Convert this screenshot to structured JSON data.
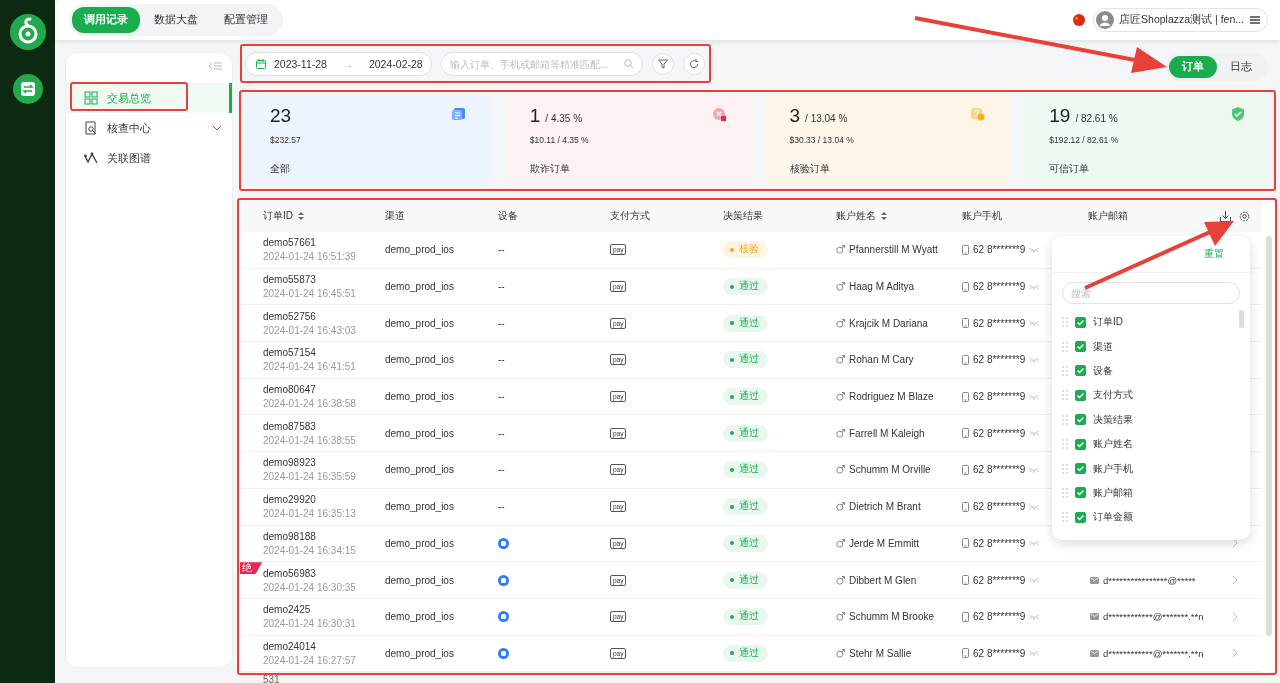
{
  "nav": {
    "tabs": [
      {
        "label": "调用记录",
        "selected": true
      },
      {
        "label": "数据大盘",
        "selected": false
      },
      {
        "label": "配置管理",
        "selected": false
      }
    ],
    "account": "店匠Shoplazza测试 | fen..."
  },
  "sidebar": {
    "items": [
      {
        "label": "交易总览",
        "kind": "overview",
        "selected": true
      },
      {
        "label": "核查中心",
        "kind": "review",
        "selected": false,
        "expanded": false
      },
      {
        "label": "关联图谱",
        "kind": "graph",
        "selected": false
      }
    ]
  },
  "filter": {
    "start_date": "2023-11-28",
    "separator": "→",
    "end_date": "2024-02-28",
    "search": {
      "placeholder": "输入订单、手机或邮箱等精准匹配..."
    }
  },
  "view_switch": [
    {
      "label": "订单",
      "selected": true
    },
    {
      "label": "日志",
      "selected": false
    }
  ],
  "stats": [
    {
      "kind": "all",
      "count": "23",
      "amount": "$232.57",
      "label": "全部"
    },
    {
      "kind": "fraud",
      "count": "1",
      "share": "/ 4.35 %",
      "amount": "$10.11 / 4.35 %",
      "label": "欺诈订单"
    },
    {
      "kind": "review",
      "count": "3",
      "share": "/ 13.04 %",
      "amount": "$30.33 / 13.04 %",
      "label": "核验订单"
    },
    {
      "kind": "trusted",
      "count": "19",
      "share": "/ 82.61 %",
      "amount": "$192.12 / 82.61 %",
      "label": "可信订单"
    }
  ],
  "table": {
    "columns": [
      {
        "label": "订单ID",
        "sortable": true
      },
      {
        "label": "渠道",
        "sortable": false
      },
      {
        "label": "设备",
        "sortable": false
      },
      {
        "label": "支付方式",
        "sortable": false
      },
      {
        "label": "决策结果",
        "sortable": false
      },
      {
        "label": "账户姓名",
        "sortable": true
      },
      {
        "label": "账户手机",
        "sortable": false
      },
      {
        "label": "账户邮箱",
        "sortable": false
      }
    ],
    "rows": [
      {
        "order_id": "demo57661",
        "time": "2024-01-24 16:51:39",
        "channel": "demo_prod_ios",
        "device": {
          "kind": "text",
          "text": "--"
        },
        "payment": "pay",
        "decision": {
          "kind": "review",
          "label": "核验"
        },
        "name": "Pfannerstill M Wyatt",
        "phone": "62 8*******9"
      },
      {
        "order_id": "demo55873",
        "time": "2024-01-24 16:45:51",
        "channel": "demo_prod_ios",
        "device": {
          "kind": "text",
          "text": "--"
        },
        "payment": "pay",
        "decision": {
          "kind": "pass",
          "label": "通过"
        },
        "name": "Haag M Aditya",
        "phone": "62 8*******9"
      },
      {
        "order_id": "demo52756",
        "time": "2024-01-24 16:43:03",
        "channel": "demo_prod_ios",
        "device": {
          "kind": "text",
          "text": "--"
        },
        "payment": "pay",
        "decision": {
          "kind": "pass",
          "label": "通过"
        },
        "name": "Krajcik M Dariana",
        "phone": "62 8*******9"
      },
      {
        "order_id": "demo57154",
        "time": "2024-01-24 16:41:51",
        "channel": "demo_prod_ios",
        "device": {
          "kind": "text",
          "text": "--"
        },
        "payment": "pay",
        "decision": {
          "kind": "pass",
          "label": "通过"
        },
        "name": "Rohan M Cary",
        "phone": "62 8*******9"
      },
      {
        "order_id": "demo80647",
        "time": "2024-01-24 16:38:58",
        "channel": "demo_prod_ios",
        "device": {
          "kind": "text",
          "text": "--"
        },
        "payment": "pay",
        "decision": {
          "kind": "pass",
          "label": "通过"
        },
        "name": "Rodriguez M Blaze",
        "phone": "62 8*******9"
      },
      {
        "order_id": "demo87583",
        "time": "2024-01-24 16:38:55",
        "channel": "demo_prod_ios",
        "device": {
          "kind": "text",
          "text": "--"
        },
        "payment": "pay",
        "decision": {
          "kind": "pass",
          "label": "通过"
        },
        "name": "Farrell M Kaleigh",
        "phone": "62 8*******9"
      },
      {
        "order_id": "demo98923",
        "time": "2024-01-24 16:35:59",
        "channel": "demo_prod_ios",
        "device": {
          "kind": "text",
          "text": "--"
        },
        "payment": "pay",
        "decision": {
          "kind": "pass",
          "label": "通过"
        },
        "name": "Schumm M Orville",
        "phone": "62 8*******9"
      },
      {
        "order_id": "demo29920",
        "time": "2024-01-24 16:35:13",
        "channel": "demo_prod_ios",
        "device": {
          "kind": "text",
          "text": "--"
        },
        "payment": "pay",
        "decision": {
          "kind": "pass",
          "label": "通过"
        },
        "name": "Dietrich M Brant",
        "phone": "62 8*******9"
      },
      {
        "order_id": "demo98188",
        "time": "2024-01-24 16:34:15",
        "channel": "demo_prod_ios",
        "device": {
          "kind": "icon"
        },
        "payment": "pay",
        "decision": {
          "kind": "pass",
          "label": "通过"
        },
        "name": "Jerde M Emmitt",
        "phone": "62 8*******9"
      },
      {
        "order_id": "demo56983",
        "time": "2024-01-24 16:30:35",
        "tag": "绝",
        "channel": "demo_prod_ios",
        "device": {
          "kind": "icon"
        },
        "payment": "pay",
        "decision": {
          "kind": "pass",
          "label": "通过"
        },
        "name": "Dibbert M Glen",
        "phone": "62 8*******9",
        "email": "d****************@*****"
      },
      {
        "order_id": "demo2425",
        "time": "2024-01-24 16:30:31",
        "channel": "demo_prod_ios",
        "device": {
          "kind": "icon"
        },
        "payment": "pay",
        "decision": {
          "kind": "pass",
          "label": "通过"
        },
        "name": "Schumm M Brooke",
        "phone": "62 8*******9",
        "email": "d************@*******.**n"
      },
      {
        "order_id": "demo24014",
        "time": "2024-01-24 16:27:57",
        "channel": "demo_prod_ios",
        "device": {
          "kind": "icon"
        },
        "payment": "pay",
        "decision": {
          "kind": "pass",
          "label": "通过"
        },
        "name": "Stehr M Sallie",
        "phone": "62 8*******9",
        "email": "d************@*******.**n"
      }
    ],
    "total": "531"
  },
  "column_settings": {
    "reset": "重置",
    "search": {
      "placeholder": "搜索"
    },
    "items": [
      {
        "label": "订单ID",
        "checked": true
      },
      {
        "label": "渠道",
        "checked": true
      },
      {
        "label": "设备",
        "checked": true
      },
      {
        "label": "支付方式",
        "checked": true
      },
      {
        "label": "决策结果",
        "checked": true
      },
      {
        "label": "账户姓名",
        "checked": true
      },
      {
        "label": "账户手机",
        "checked": true
      },
      {
        "label": "账户邮箱",
        "checked": true
      },
      {
        "label": "订单金额",
        "checked": true
      }
    ]
  }
}
